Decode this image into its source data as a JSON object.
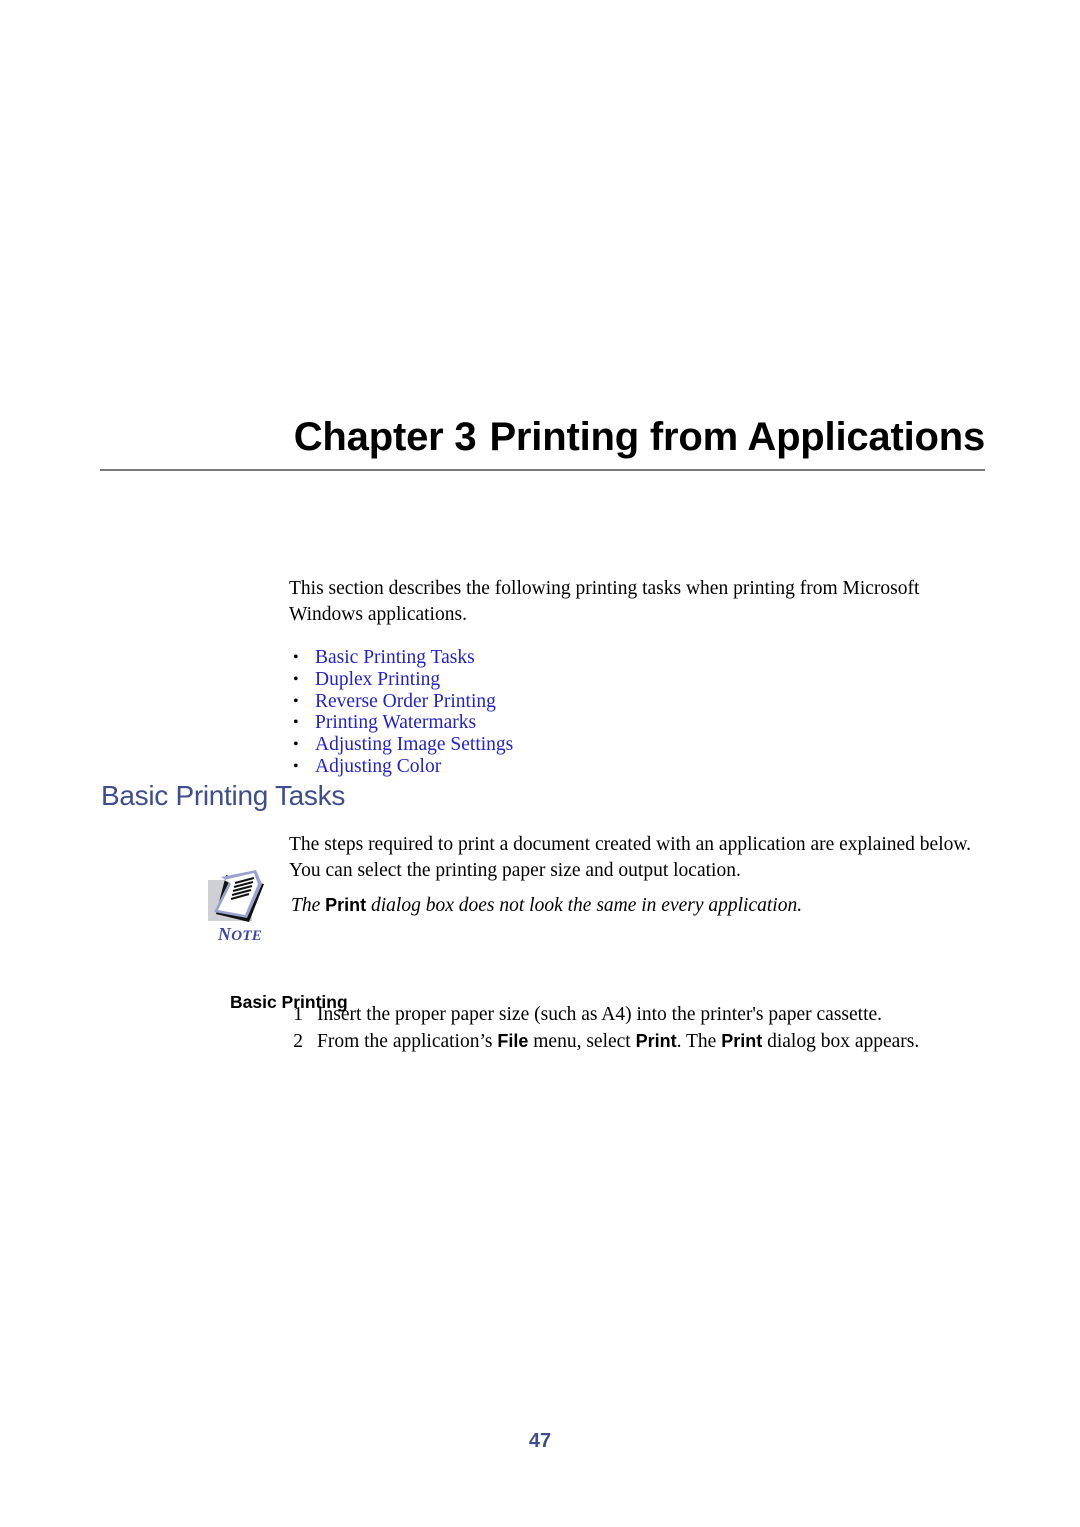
{
  "chapter": {
    "label": "Chapter",
    "number": "3",
    "title": "Printing from Applications",
    "full_heading": "Chapter 3  Printing from Applications"
  },
  "intro": {
    "paragraph": "This section describes the following printing tasks when printing from Microsoft Windows applications."
  },
  "link_list": {
    "bullet_glyph": "•",
    "items": [
      {
        "label": "Basic Printing Tasks"
      },
      {
        "label": "Duplex Printing"
      },
      {
        "label": "Reverse Order Printing"
      },
      {
        "label": "Printing Watermarks"
      },
      {
        "label": "Adjusting Image Settings"
      },
      {
        "label": "Adjusting Color"
      }
    ]
  },
  "section": {
    "heading": "Basic Printing Tasks",
    "paragraph": "The steps required to print a document created with an application are explained below. You can select the printing paper size and output location."
  },
  "note": {
    "icon_name": "note-pad-icon",
    "label_first": "N",
    "label_rest": "OTE",
    "text_before": "The ",
    "keyword": "Print",
    "text_after": " dialog box does not look the same in every application."
  },
  "steps": {
    "heading": "Basic Printing",
    "items": [
      {
        "number": "1",
        "segments": [
          {
            "text": "Insert the proper paper size (such as A4) into the printer's paper cassette.",
            "bold": false
          }
        ]
      },
      {
        "number": "2",
        "segments": [
          {
            "text": "From the application’s ",
            "bold": false
          },
          {
            "text": "File",
            "bold": true
          },
          {
            "text": " menu, select ",
            "bold": false
          },
          {
            "text": "Print",
            "bold": true
          },
          {
            "text": ". The ",
            "bold": false
          },
          {
            "text": "Print",
            "bold": true
          },
          {
            "text": " dialog box appears.",
            "bold": false
          }
        ]
      }
    ]
  },
  "folio": {
    "page_number": "47"
  },
  "colors": {
    "heading_blue": "#3e4d8d",
    "link_blue": "#2222cc",
    "rule_gray": "#7a7a7a",
    "note_label_blue": "#3a46a8"
  }
}
